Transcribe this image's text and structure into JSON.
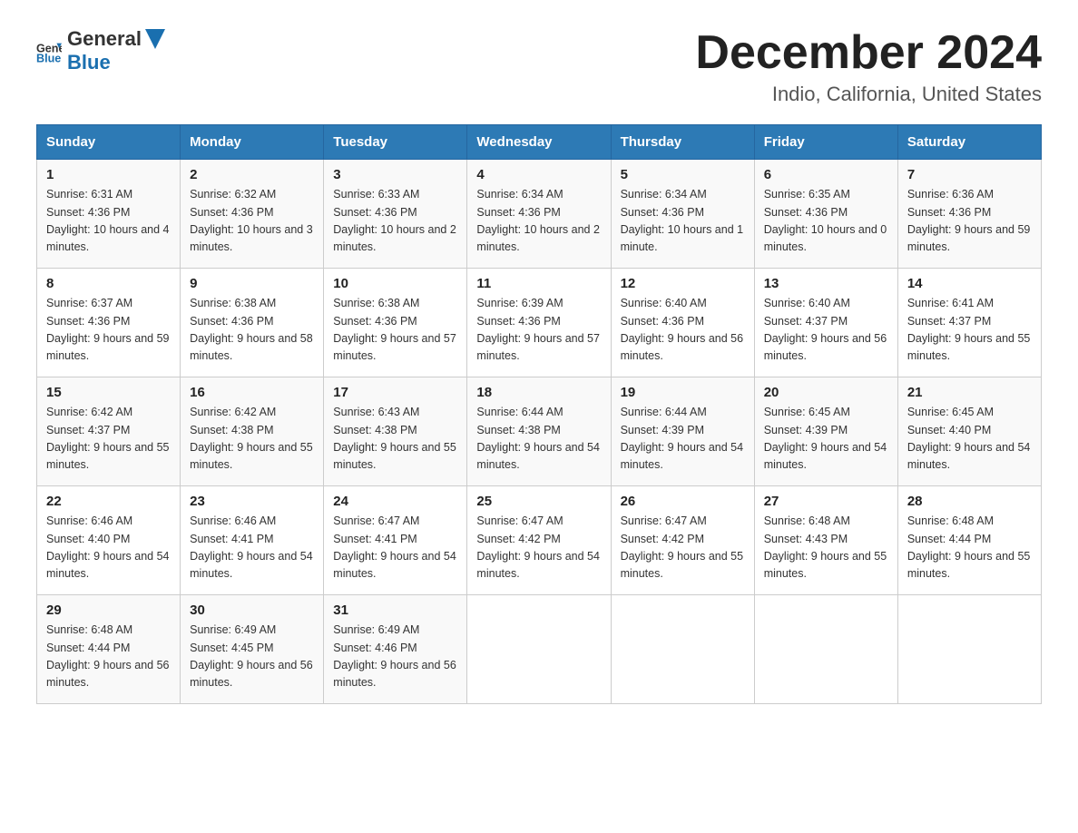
{
  "logo": {
    "text_general": "General",
    "text_blue": "Blue"
  },
  "title": "December 2024",
  "location": "Indio, California, United States",
  "days_of_week": [
    "Sunday",
    "Monday",
    "Tuesday",
    "Wednesday",
    "Thursday",
    "Friday",
    "Saturday"
  ],
  "weeks": [
    [
      {
        "day": "1",
        "sunrise": "6:31 AM",
        "sunset": "4:36 PM",
        "daylight": "10 hours and 4 minutes."
      },
      {
        "day": "2",
        "sunrise": "6:32 AM",
        "sunset": "4:36 PM",
        "daylight": "10 hours and 3 minutes."
      },
      {
        "day": "3",
        "sunrise": "6:33 AM",
        "sunset": "4:36 PM",
        "daylight": "10 hours and 2 minutes."
      },
      {
        "day": "4",
        "sunrise": "6:34 AM",
        "sunset": "4:36 PM",
        "daylight": "10 hours and 2 minutes."
      },
      {
        "day": "5",
        "sunrise": "6:34 AM",
        "sunset": "4:36 PM",
        "daylight": "10 hours and 1 minute."
      },
      {
        "day": "6",
        "sunrise": "6:35 AM",
        "sunset": "4:36 PM",
        "daylight": "10 hours and 0 minutes."
      },
      {
        "day": "7",
        "sunrise": "6:36 AM",
        "sunset": "4:36 PM",
        "daylight": "9 hours and 59 minutes."
      }
    ],
    [
      {
        "day": "8",
        "sunrise": "6:37 AM",
        "sunset": "4:36 PM",
        "daylight": "9 hours and 59 minutes."
      },
      {
        "day": "9",
        "sunrise": "6:38 AM",
        "sunset": "4:36 PM",
        "daylight": "9 hours and 58 minutes."
      },
      {
        "day": "10",
        "sunrise": "6:38 AM",
        "sunset": "4:36 PM",
        "daylight": "9 hours and 57 minutes."
      },
      {
        "day": "11",
        "sunrise": "6:39 AM",
        "sunset": "4:36 PM",
        "daylight": "9 hours and 57 minutes."
      },
      {
        "day": "12",
        "sunrise": "6:40 AM",
        "sunset": "4:36 PM",
        "daylight": "9 hours and 56 minutes."
      },
      {
        "day": "13",
        "sunrise": "6:40 AM",
        "sunset": "4:37 PM",
        "daylight": "9 hours and 56 minutes."
      },
      {
        "day": "14",
        "sunrise": "6:41 AM",
        "sunset": "4:37 PM",
        "daylight": "9 hours and 55 minutes."
      }
    ],
    [
      {
        "day": "15",
        "sunrise": "6:42 AM",
        "sunset": "4:37 PM",
        "daylight": "9 hours and 55 minutes."
      },
      {
        "day": "16",
        "sunrise": "6:42 AM",
        "sunset": "4:38 PM",
        "daylight": "9 hours and 55 minutes."
      },
      {
        "day": "17",
        "sunrise": "6:43 AM",
        "sunset": "4:38 PM",
        "daylight": "9 hours and 55 minutes."
      },
      {
        "day": "18",
        "sunrise": "6:44 AM",
        "sunset": "4:38 PM",
        "daylight": "9 hours and 54 minutes."
      },
      {
        "day": "19",
        "sunrise": "6:44 AM",
        "sunset": "4:39 PM",
        "daylight": "9 hours and 54 minutes."
      },
      {
        "day": "20",
        "sunrise": "6:45 AM",
        "sunset": "4:39 PM",
        "daylight": "9 hours and 54 minutes."
      },
      {
        "day": "21",
        "sunrise": "6:45 AM",
        "sunset": "4:40 PM",
        "daylight": "9 hours and 54 minutes."
      }
    ],
    [
      {
        "day": "22",
        "sunrise": "6:46 AM",
        "sunset": "4:40 PM",
        "daylight": "9 hours and 54 minutes."
      },
      {
        "day": "23",
        "sunrise": "6:46 AM",
        "sunset": "4:41 PM",
        "daylight": "9 hours and 54 minutes."
      },
      {
        "day": "24",
        "sunrise": "6:47 AM",
        "sunset": "4:41 PM",
        "daylight": "9 hours and 54 minutes."
      },
      {
        "day": "25",
        "sunrise": "6:47 AM",
        "sunset": "4:42 PM",
        "daylight": "9 hours and 54 minutes."
      },
      {
        "day": "26",
        "sunrise": "6:47 AM",
        "sunset": "4:42 PM",
        "daylight": "9 hours and 55 minutes."
      },
      {
        "day": "27",
        "sunrise": "6:48 AM",
        "sunset": "4:43 PM",
        "daylight": "9 hours and 55 minutes."
      },
      {
        "day": "28",
        "sunrise": "6:48 AM",
        "sunset": "4:44 PM",
        "daylight": "9 hours and 55 minutes."
      }
    ],
    [
      {
        "day": "29",
        "sunrise": "6:48 AM",
        "sunset": "4:44 PM",
        "daylight": "9 hours and 56 minutes."
      },
      {
        "day": "30",
        "sunrise": "6:49 AM",
        "sunset": "4:45 PM",
        "daylight": "9 hours and 56 minutes."
      },
      {
        "day": "31",
        "sunrise": "6:49 AM",
        "sunset": "4:46 PM",
        "daylight": "9 hours and 56 minutes."
      },
      null,
      null,
      null,
      null
    ]
  ],
  "labels": {
    "sunrise": "Sunrise:",
    "sunset": "Sunset:",
    "daylight": "Daylight:"
  }
}
